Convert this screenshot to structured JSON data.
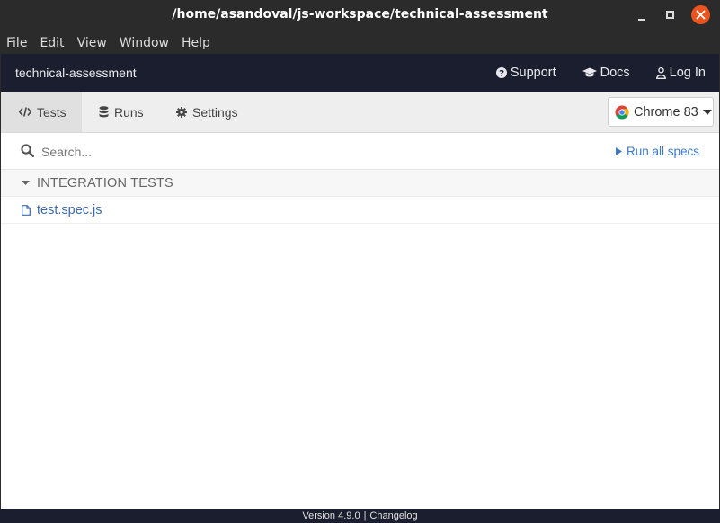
{
  "window": {
    "title": "/home/asandoval/js-workspace/technical-assessment",
    "menu": [
      "File",
      "Edit",
      "View",
      "Window",
      "Help"
    ]
  },
  "topnav": {
    "project_name": "technical-assessment",
    "support_label": "Support",
    "docs_label": "Docs",
    "login_label": "Log In"
  },
  "tabs": {
    "tests_label": "Tests",
    "runs_label": "Runs",
    "settings_label": "Settings",
    "browser_label": "Chrome 83"
  },
  "search": {
    "placeholder": "Search...",
    "run_all_label": "Run all specs"
  },
  "specs": {
    "group_label": "INTEGRATION TESTS",
    "files": [
      "test.spec.js"
    ]
  },
  "footer": {
    "version": "Version 4.9.0",
    "separator": "|",
    "changelog": "Changelog"
  },
  "colors": {
    "nav_bg": "#1b1e2e",
    "link_blue": "#3c7ac6",
    "close_button": "#e9541f"
  },
  "icons": {
    "tests": "code-icon",
    "runs": "database-icon",
    "settings": "gear-icon",
    "support": "question-circle-icon",
    "docs": "graduation-cap-icon",
    "login": "user-icon",
    "search": "search-icon",
    "run_all": "play-icon",
    "group": "caret-down-icon",
    "spec": "file-icon",
    "browser": "chrome-icon"
  }
}
